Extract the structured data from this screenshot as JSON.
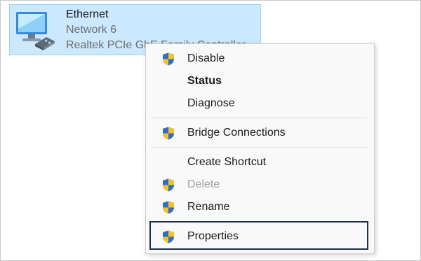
{
  "adapter": {
    "name": "Ethernet",
    "network": "Network 6",
    "device": "Realtek PCIe GbE Family Controller",
    "icon": "network-adapter-icon",
    "selection_color": "#cce8ff"
  },
  "context_menu": {
    "items": [
      {
        "label": "Disable",
        "icon": "uac-shield-icon",
        "bold": false,
        "disabled": false
      },
      {
        "label": "Status",
        "icon": null,
        "bold": true,
        "disabled": false
      },
      {
        "label": "Diagnose",
        "icon": null,
        "bold": false,
        "disabled": false
      },
      {
        "label": "Bridge Connections",
        "icon": "uac-shield-icon",
        "bold": false,
        "disabled": false
      },
      {
        "label": "Create Shortcut",
        "icon": null,
        "bold": false,
        "disabled": false
      },
      {
        "label": "Delete",
        "icon": "uac-shield-icon",
        "bold": false,
        "disabled": true
      },
      {
        "label": "Rename",
        "icon": "uac-shield-icon",
        "bold": false,
        "disabled": false
      },
      {
        "label": "Properties",
        "icon": "uac-shield-icon",
        "bold": false,
        "disabled": false,
        "highlighted": true
      }
    ],
    "highlight_color": "#1b3150"
  }
}
